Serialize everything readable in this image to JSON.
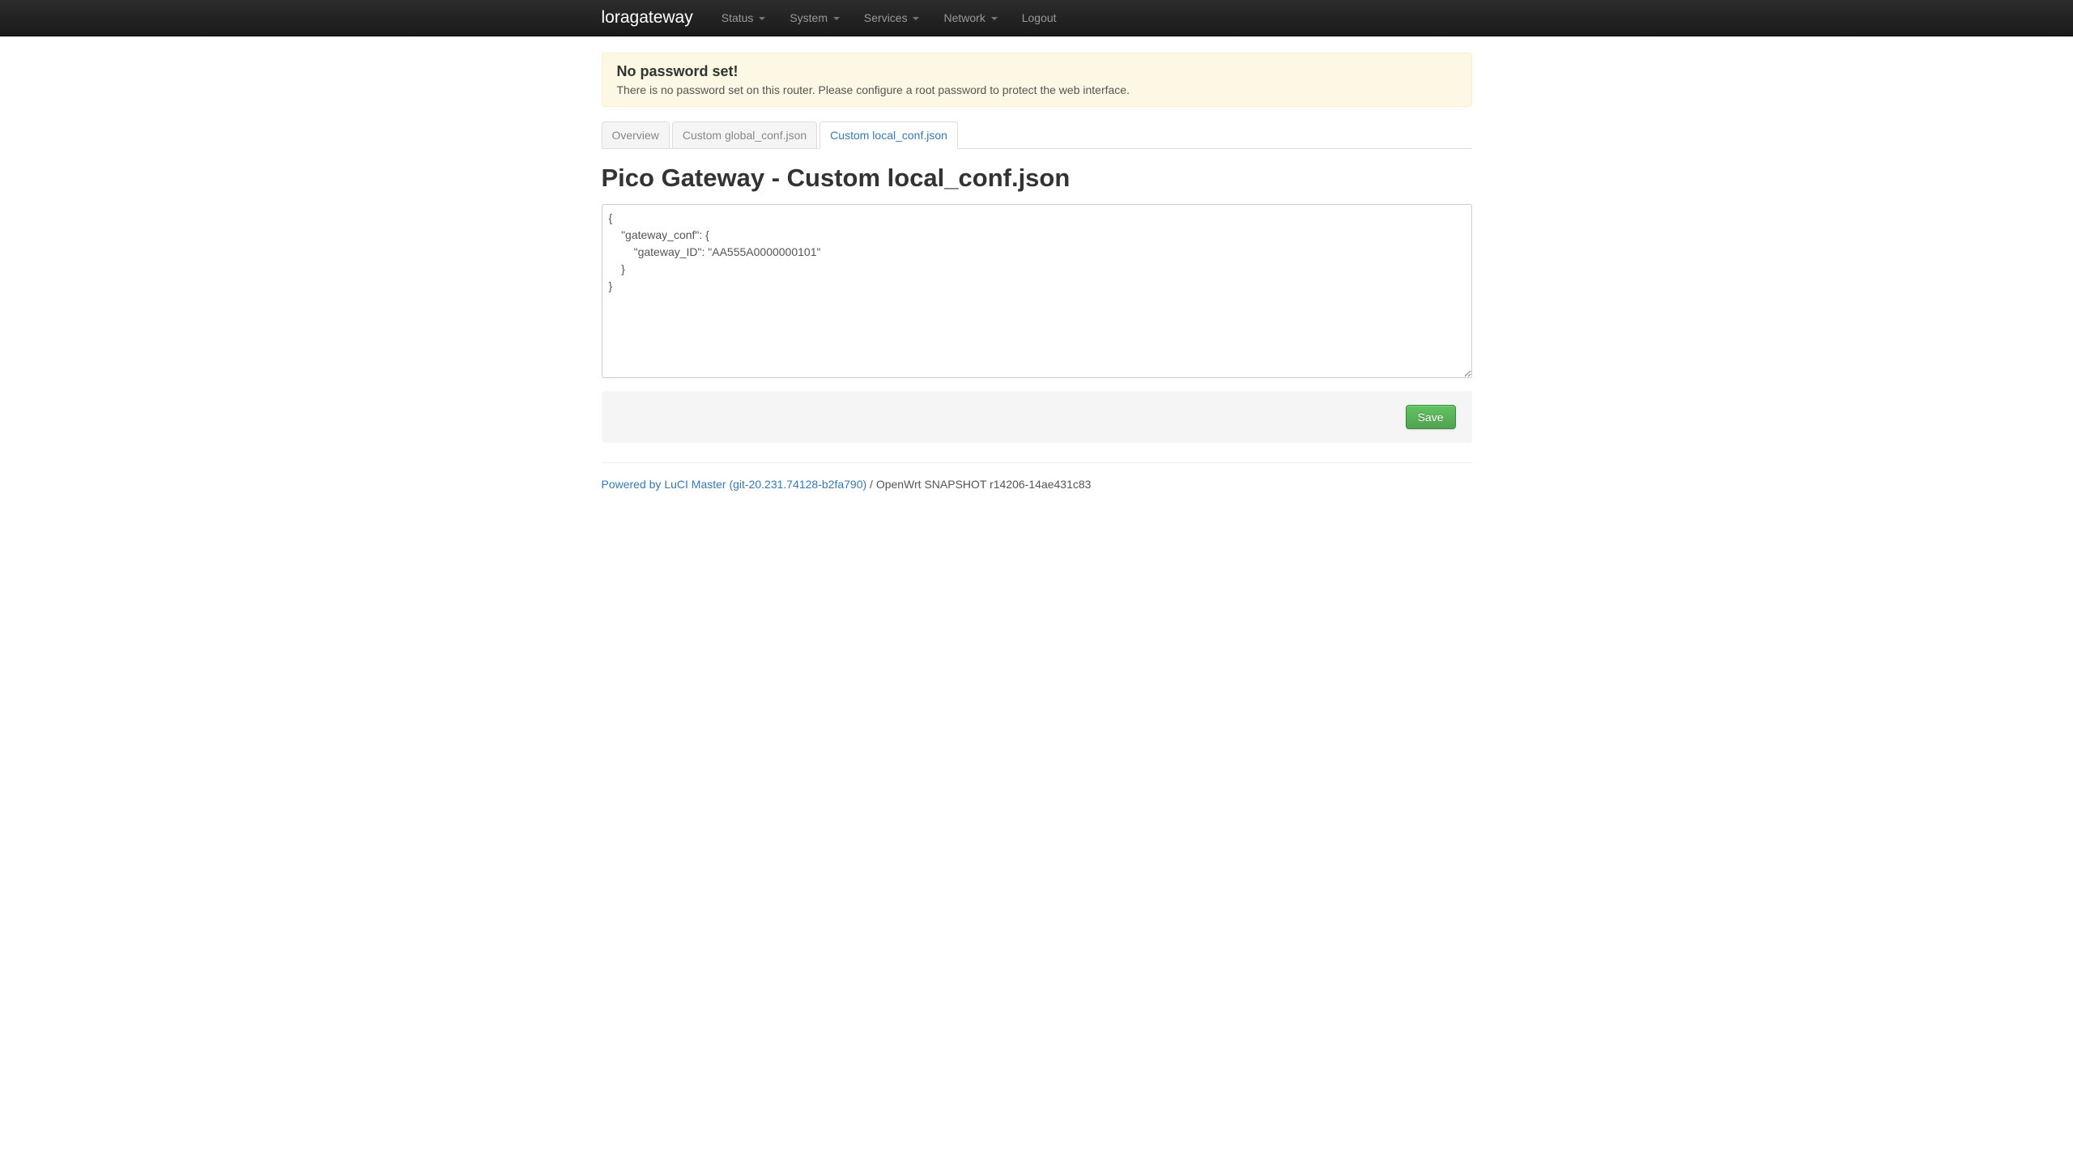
{
  "brand": "loragateway",
  "nav": {
    "status": "Status",
    "system": "System",
    "services": "Services",
    "network": "Network",
    "logout": "Logout"
  },
  "alert": {
    "title": "No password set!",
    "body": "There is no password set on this router. Please configure a root password to protect the web interface."
  },
  "tabs": {
    "overview": "Overview",
    "global": "Custom global_conf.json",
    "local": "Custom local_conf.json"
  },
  "page_title": "Pico Gateway - Custom local_conf.json",
  "config_text": "{\n    \"gateway_conf\": {\n        \"gateway_ID\": \"AA555A0000000101\"\n    }\n}",
  "save_label": "Save",
  "footer": {
    "link_text": "Powered by LuCI Master (git-20.231.74128-b2fa790)",
    "separator": " / ",
    "version": "OpenWrt SNAPSHOT r14206-14ae431c83"
  }
}
